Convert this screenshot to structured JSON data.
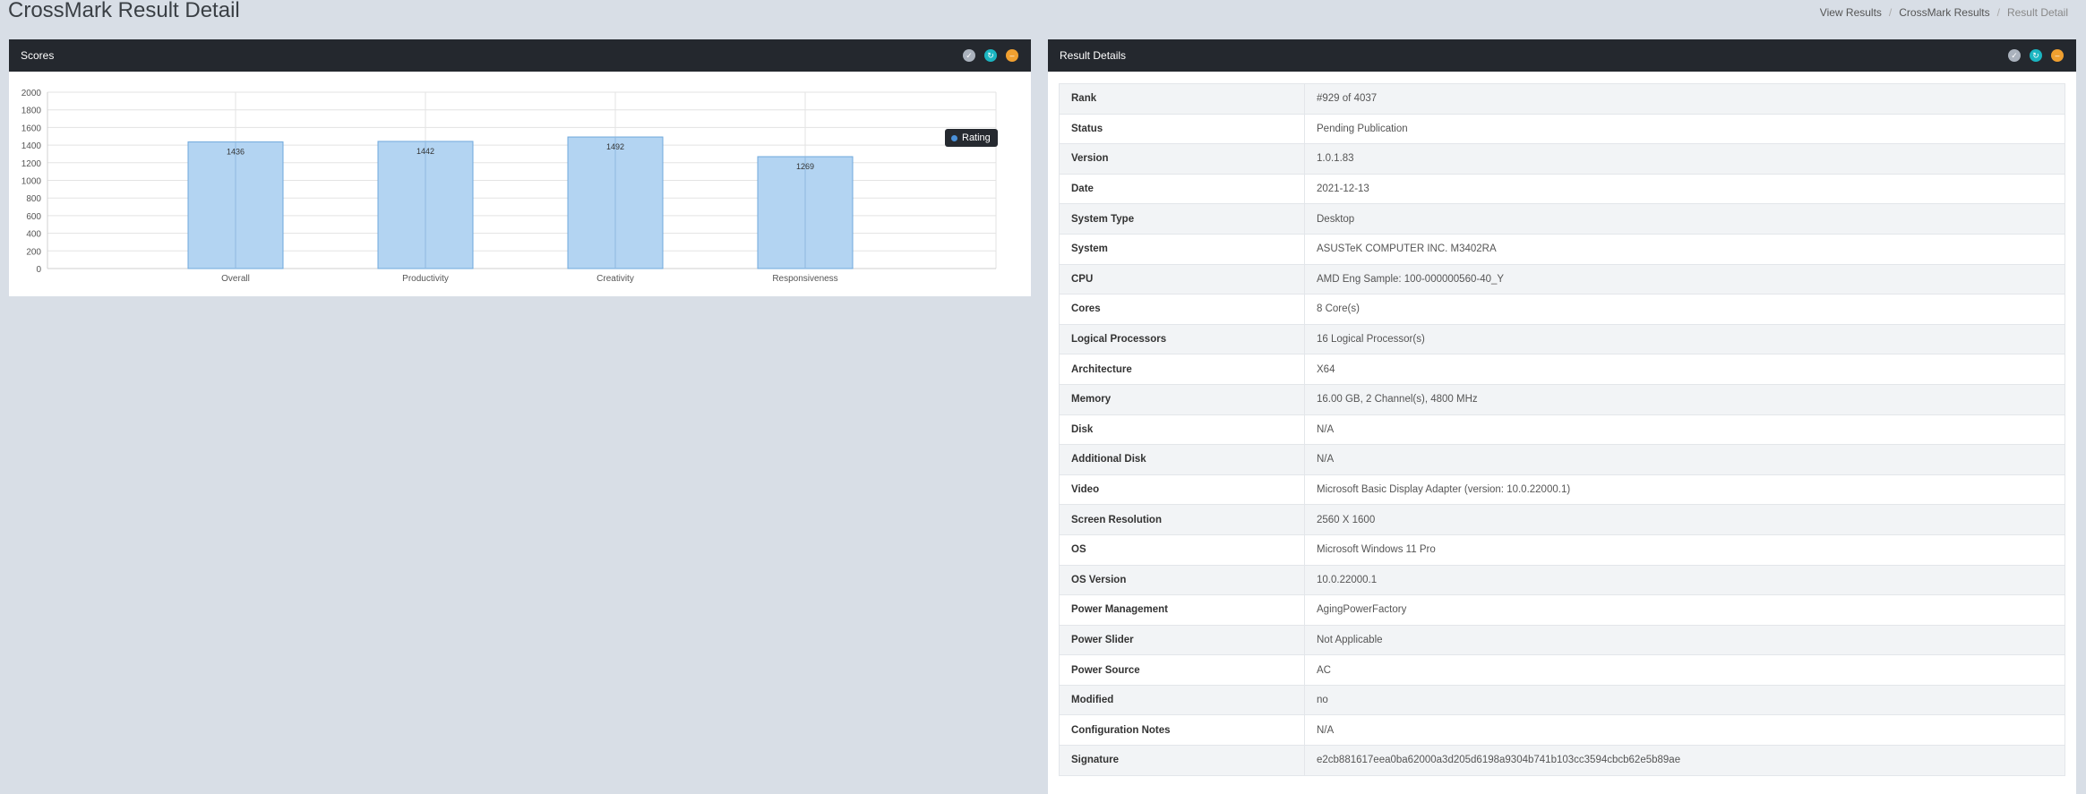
{
  "page_title": "CrossMark Result Detail",
  "breadcrumb": [
    "View Results",
    "CrossMark Results",
    "Result Detail"
  ],
  "scores_panel": {
    "title": "Scores"
  },
  "details_panel": {
    "title": "Result Details"
  },
  "panel_tools": [
    "check-icon",
    "refresh-icon",
    "minus-icon"
  ],
  "chart_data": {
    "type": "bar",
    "categories": [
      "Overall",
      "Productivity",
      "Creativity",
      "Responsiveness"
    ],
    "series": [
      {
        "name": "Rating",
        "values": [
          1436,
          1442,
          1492,
          1269
        ]
      }
    ],
    "ylim": [
      0,
      2000
    ],
    "yticks": [
      "0",
      "200",
      "400",
      "600",
      "800",
      "1000",
      "1200",
      "1400",
      "1600",
      "1800",
      "2000"
    ],
    "grid": true,
    "legend": "top-right",
    "bar_color": "#b3d4f2",
    "bar_border": "#6fa8dc"
  },
  "details": [
    {
      "label": "Rank",
      "value": "#929 of 4037"
    },
    {
      "label": "Status",
      "value": "Pending Publication"
    },
    {
      "label": "Version",
      "value": "1.0.1.83"
    },
    {
      "label": "Date",
      "value": "2021-12-13"
    },
    {
      "label": "System Type",
      "value": "Desktop"
    },
    {
      "label": "System",
      "value": "ASUSTeK COMPUTER INC. M3402RA"
    },
    {
      "label": "CPU",
      "value": "AMD Eng Sample: 100-000000560-40_Y"
    },
    {
      "label": "Cores",
      "value": "8 Core(s)"
    },
    {
      "label": "Logical Processors",
      "value": "16 Logical Processor(s)"
    },
    {
      "label": "Architecture",
      "value": "X64"
    },
    {
      "label": "Memory",
      "value": "16.00 GB, 2 Channel(s), 4800 MHz"
    },
    {
      "label": "Disk",
      "value": "N/A"
    },
    {
      "label": "Additional Disk",
      "value": "N/A"
    },
    {
      "label": "Video",
      "value": "Microsoft Basic Display Adapter (version: 10.0.22000.1)"
    },
    {
      "label": "Screen Resolution",
      "value": "2560 X 1600"
    },
    {
      "label": "OS",
      "value": "Microsoft Windows 11 Pro"
    },
    {
      "label": "OS Version",
      "value": "10.0.22000.1"
    },
    {
      "label": "Power Management",
      "value": "AgingPowerFactory"
    },
    {
      "label": "Power Slider",
      "value": "Not Applicable"
    },
    {
      "label": "Power Source",
      "value": "AC"
    },
    {
      "label": "Modified",
      "value": "no"
    },
    {
      "label": "Configuration Notes",
      "value": "N/A"
    },
    {
      "label": "Signature",
      "value": "e2cb881617eea0ba62000a3d205d6198a9304b741b103cc3594cbcb62e5b89ae"
    }
  ],
  "colors": {
    "status_pending": "#e04b4b",
    "header_bg": "#24282e",
    "page_bg": "#d8dee6"
  }
}
